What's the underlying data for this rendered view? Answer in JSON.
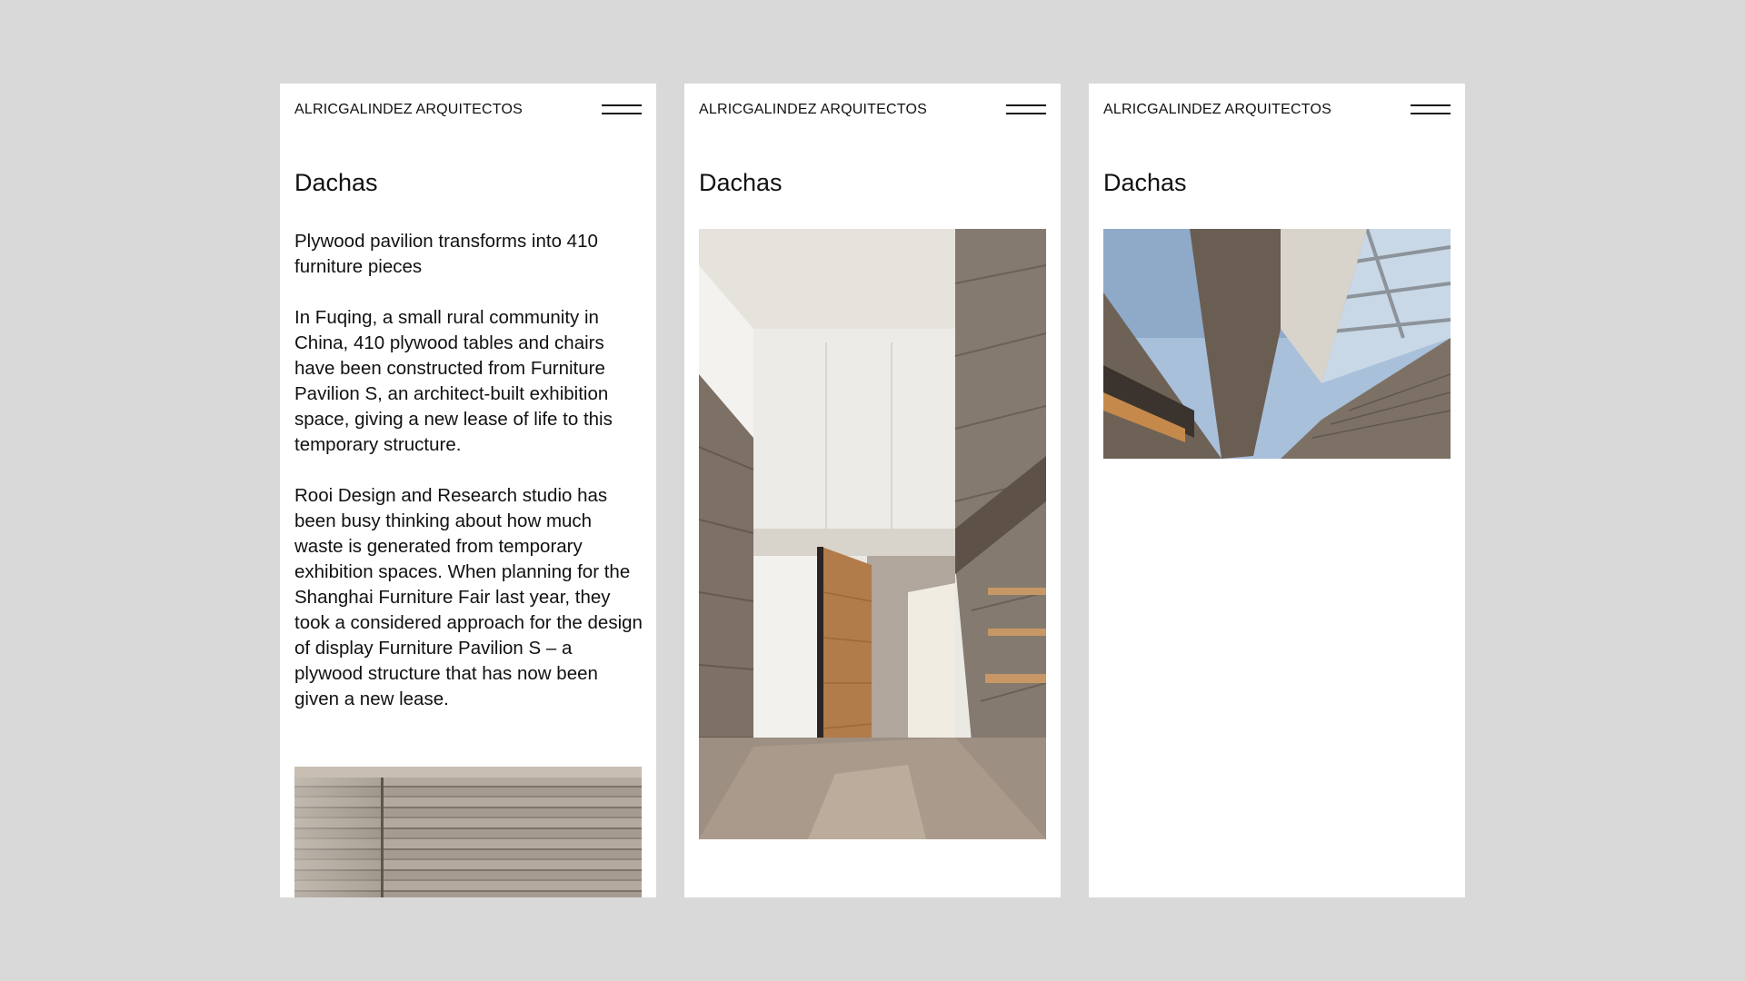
{
  "screens": [
    {
      "brand": "ALRICGALINDEZ ARQUITECTOS",
      "menu_icon": "hamburger-menu-icon",
      "title": "Dachas",
      "paragraphs": [
        "Plywood pavilion transforms into 410 furniture pieces",
        "In Fuqing, a small rural community in China, 410 plywood tables and chairs have been constructed from Furniture Pavilion S, an architect-built exhibition space, giving a new lease of life to this temporary structure.",
        "Rooi Design and Research studio has been busy thinking about how much waste is generated from temporary exhibition spaces. When planning for the Shanghai Furniture Fair last year, they took a considered approach for the design of display Furniture Pavilion S – a plywood structure that has now been given a new lease."
      ],
      "image": "concrete-wall-photo"
    },
    {
      "brand": "ALRICGALINDEZ ARQUITECTOS",
      "menu_icon": "hamburger-menu-icon",
      "title": "Dachas",
      "image": "interior-pivot-door-photo"
    },
    {
      "brand": "ALRICGALINDEZ ARQUITECTOS",
      "menu_icon": "hamburger-menu-icon",
      "title": "Dachas",
      "image": "skylight-photo"
    }
  ],
  "colors": {
    "background": "#d9d9d9",
    "card": "#ffffff",
    "text": "#111111"
  }
}
